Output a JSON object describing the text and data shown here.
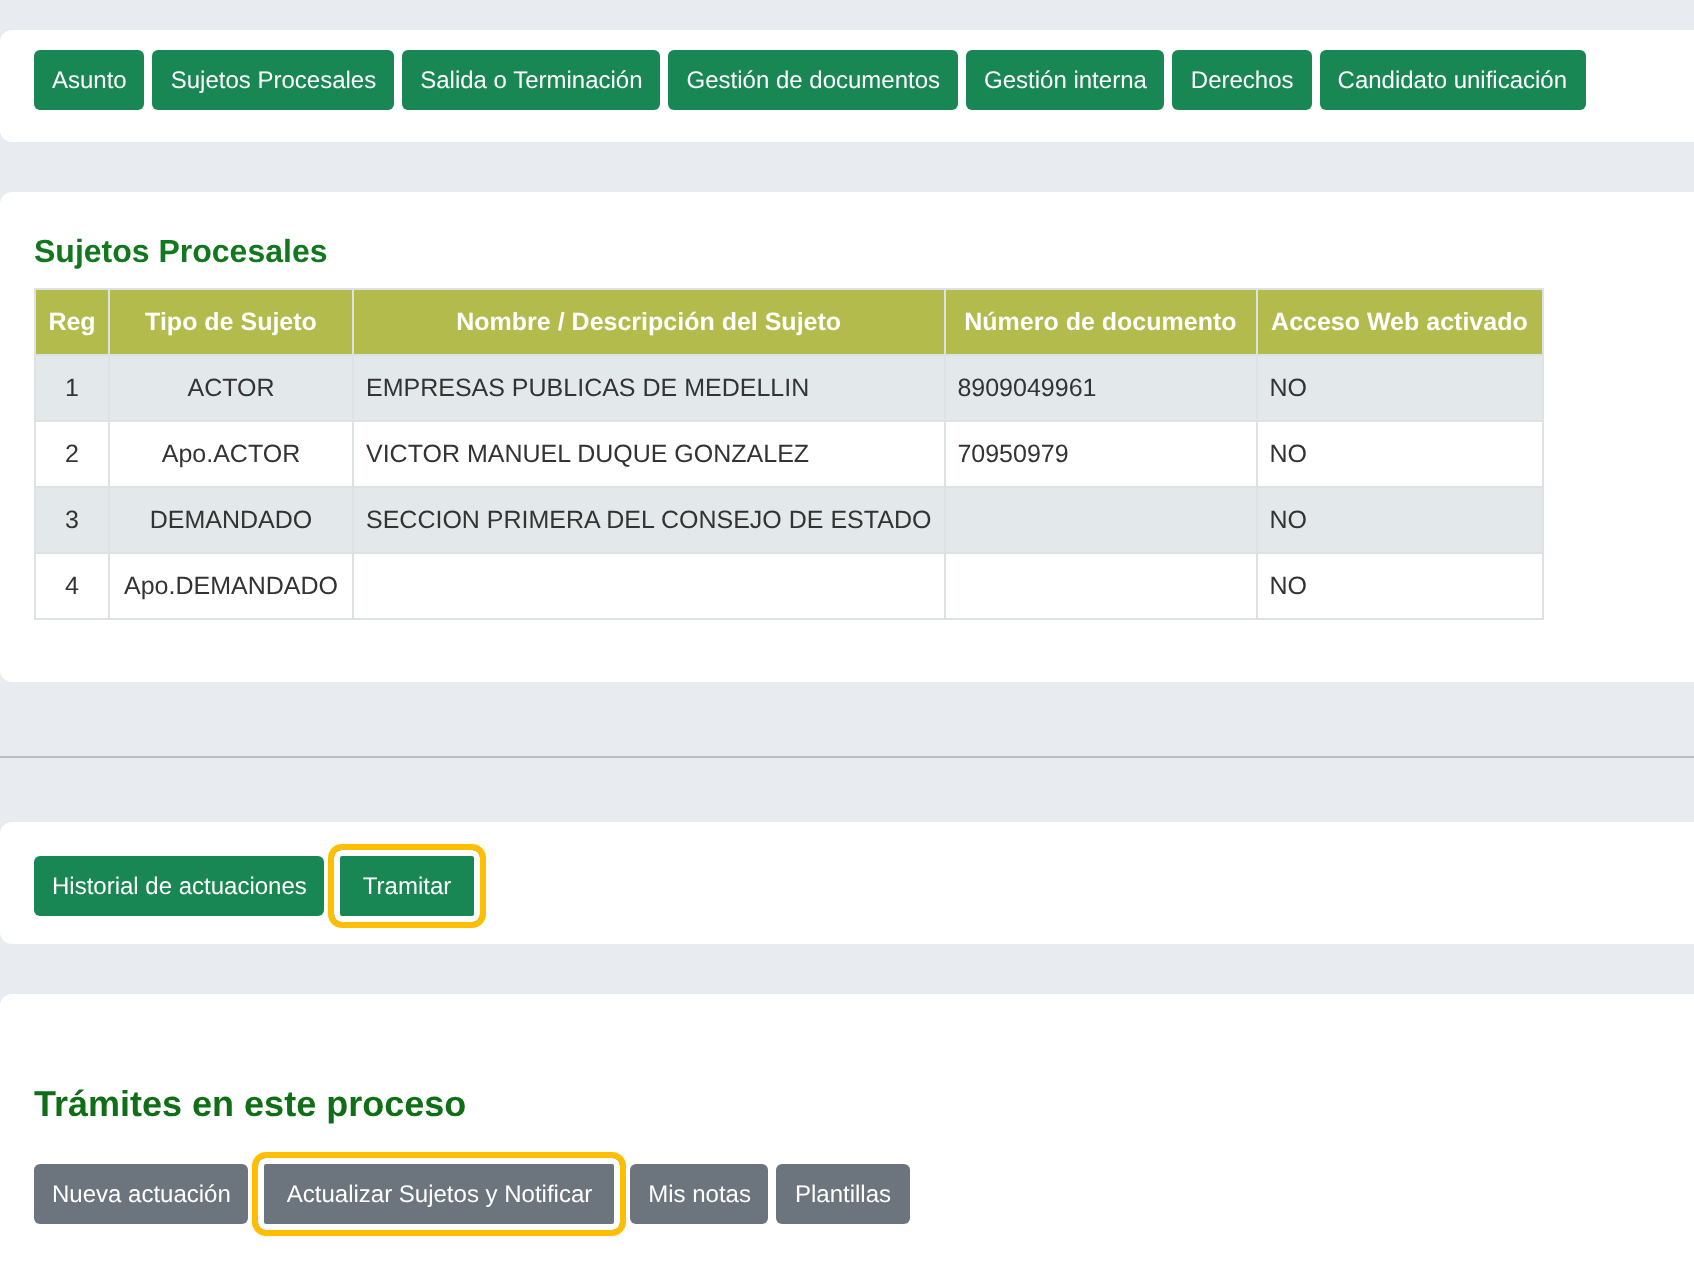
{
  "top_tabs": [
    {
      "label": "Asunto"
    },
    {
      "label": "Sujetos Procesales"
    },
    {
      "label": "Salida o Terminación"
    },
    {
      "label": "Gestión de documentos"
    },
    {
      "label": "Gestión interna"
    },
    {
      "label": "Derechos"
    },
    {
      "label": "Candidato unificación"
    }
  ],
  "subjects": {
    "title": "Sujetos Procesales",
    "columns": [
      "Reg",
      "Tipo de Sujeto",
      "Nombre / Descripción del Sujeto",
      "Número de documento",
      "Acceso Web activado"
    ],
    "rows": [
      [
        "1",
        "ACTOR",
        "EMPRESAS PUBLICAS DE MEDELLIN",
        "8909049961",
        "NO"
      ],
      [
        "2",
        "Apo.ACTOR",
        "VICTOR MANUEL DUQUE GONZALEZ",
        "70950979",
        "NO"
      ],
      [
        "3",
        "DEMANDADO",
        "SECCION PRIMERA DEL CONSEJO DE ESTADO",
        "",
        "NO"
      ],
      [
        "4",
        "Apo.DEMANDADO",
        "",
        "",
        "NO"
      ]
    ]
  },
  "actions": [
    {
      "label": "Historial de actuaciones",
      "kind": "primary",
      "highlighted": false
    },
    {
      "label": "Tramitar",
      "kind": "primary",
      "highlighted": true
    }
  ],
  "procedures": {
    "title": "Trámites en este proceso",
    "buttons": [
      {
        "label": "Nueva actuación",
        "kind": "secondary",
        "highlighted": false
      },
      {
        "label": "Actualizar Sujetos y Notificar",
        "kind": "secondary",
        "highlighted": true
      },
      {
        "label": "Mis notas",
        "kind": "secondary",
        "highlighted": false
      },
      {
        "label": "Plantillas",
        "kind": "secondary",
        "highlighted": false
      }
    ]
  }
}
